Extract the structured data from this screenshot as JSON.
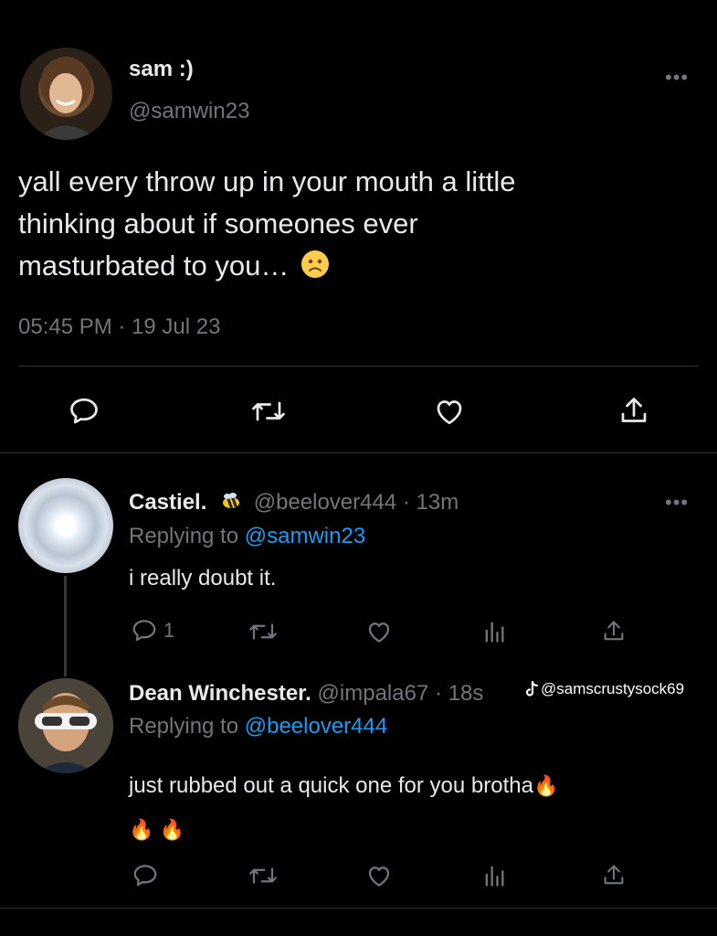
{
  "main_tweet": {
    "display_name": "sam :)",
    "handle": "@samwin23",
    "text_line1": "yall every throw up in your mouth a little",
    "text_line2": "thinking about if someones ever",
    "text_line3": "masturbated to you…",
    "timestamp": "05:45 PM · 19 Jul 23",
    "actions": [
      "reply-icon",
      "retweet-icon",
      "like-icon",
      "share-icon"
    ]
  },
  "reply1": {
    "display_name": "Castiel.",
    "handle": "@beelover444",
    "time": "· 13m",
    "replying_prefix": "Replying to",
    "replying_to": "@samwin23",
    "text": "i really doubt it.",
    "reply_count": "1"
  },
  "reply2": {
    "display_name": "Dean Winchester.",
    "handle": "@impala67",
    "time": "· 18s",
    "replying_prefix": "Replying to",
    "replying_to": "@beelover444",
    "text_line1": "just rubbed out a quick one for you brotha",
    "emoji_line2": "🔥 🔥"
  },
  "watermark": {
    "text": "@samscrustysock69"
  },
  "colors": {
    "background": "#000000",
    "text": "#e7e9ea",
    "secondary": "#71767b",
    "link": "#1d9bf0",
    "divider": "#2f3336"
  }
}
